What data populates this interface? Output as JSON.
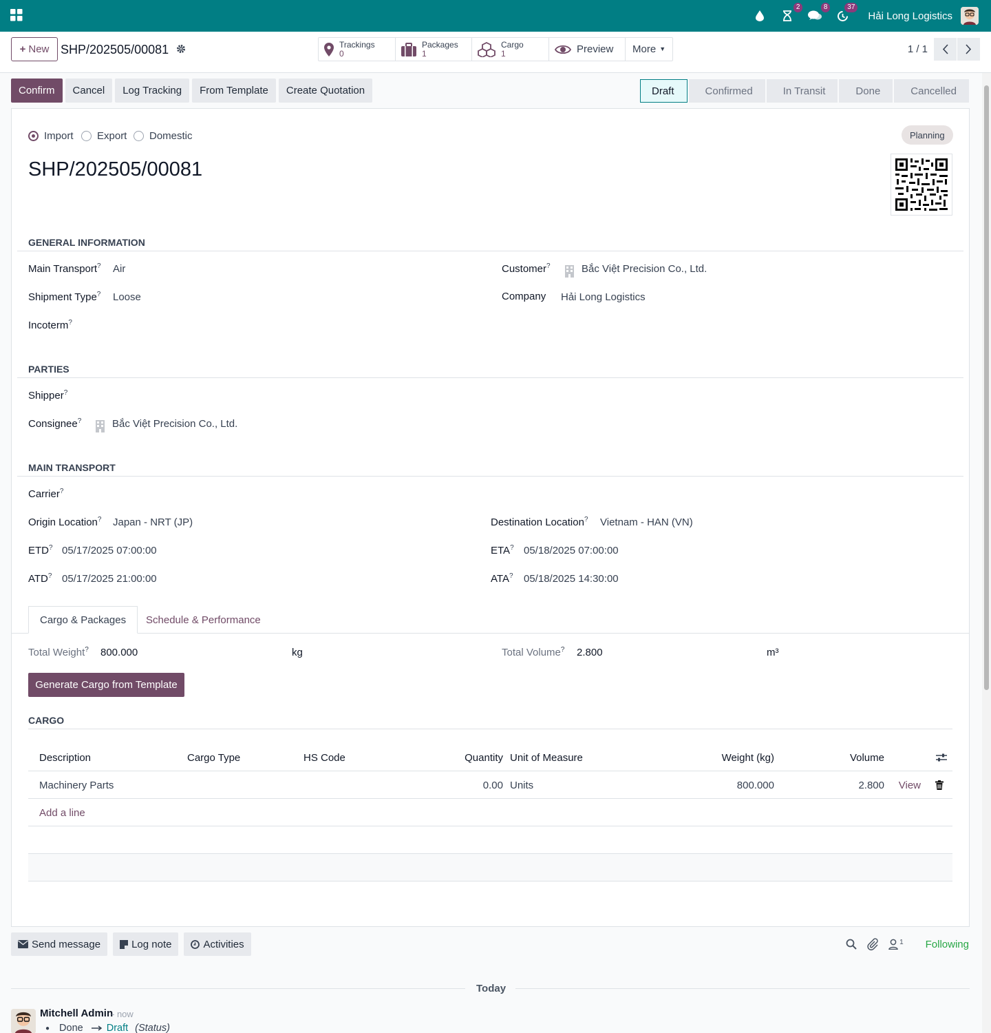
{
  "topbar": {
    "company": "Hải Long Logistics",
    "badges": {
      "activities": "2",
      "messages": "8",
      "timer": "37"
    }
  },
  "control_panel": {
    "new_label": "New",
    "record_name": "SHP/202505/00081",
    "stats": [
      {
        "label": "Trackings",
        "value": "0"
      },
      {
        "label": "Packages",
        "value": "1"
      },
      {
        "label": "Cargo",
        "value": "1"
      }
    ],
    "preview_label": "Preview",
    "more_label": "More",
    "pager": "1 / 1"
  },
  "actions": [
    "Confirm",
    "Cancel",
    "Log Tracking",
    "From Template",
    "Create Quotation"
  ],
  "statusbar": [
    "Draft",
    "Confirmed",
    "In Transit",
    "Done",
    "Cancelled"
  ],
  "statusbar_active": "Draft",
  "form": {
    "direction": {
      "options": [
        "Import",
        "Export",
        "Domestic"
      ],
      "selected": "Import"
    },
    "planning_tag": "Planning",
    "title": "SHP/202505/00081",
    "general": {
      "heading": "GENERAL INFORMATION",
      "main_transport_label": "Main Transport",
      "main_transport": "Air",
      "shipment_type_label": "Shipment Type",
      "shipment_type": "Loose",
      "incoterm_label": "Incoterm",
      "customer_label": "Customer",
      "customer": "Bắc Việt Precision Co., Ltd.",
      "company_label": "Company",
      "company": "Hải Long Logistics"
    },
    "parties": {
      "heading": "PARTIES",
      "shipper_label": "Shipper",
      "consignee_label": "Consignee",
      "consignee": "Bắc Việt Precision Co., Ltd."
    },
    "main_transport": {
      "heading": "MAIN TRANSPORT",
      "carrier_label": "Carrier",
      "origin_label": "Origin Location",
      "origin": "Japan - NRT (JP)",
      "destination_label": "Destination Location",
      "destination": "Vietnam - HAN (VN)",
      "etd_label": "ETD",
      "etd": "05/17/2025 07:00:00",
      "eta_label": "ETA",
      "eta": "05/18/2025 07:00:00",
      "atd_label": "ATD",
      "atd": "05/17/2025 21:00:00",
      "ata_label": "ATA",
      "ata": "05/18/2025 14:30:00"
    },
    "tabs": [
      "Cargo & Packages",
      "Schedule & Performance"
    ],
    "totals": {
      "weight_label": "Total Weight",
      "weight": "800.000",
      "weight_unit": "kg",
      "volume_label": "Total Volume",
      "volume": "2.800",
      "volume_unit": "m³"
    },
    "generate_label": "Generate Cargo from Template",
    "cargo": {
      "heading": "CARGO",
      "columns": [
        "Description",
        "Cargo Type",
        "HS Code",
        "Quantity",
        "Unit of Measure",
        "Weight (kg)",
        "Volume"
      ],
      "rows": [
        {
          "description": "Machinery Parts",
          "cargo_type": "",
          "hs_code": "",
          "quantity": "0.00",
          "uom": "Units",
          "weight": "800.000",
          "volume": "2.800",
          "action": "View"
        }
      ],
      "add_line": "Add a line"
    }
  },
  "chatter": {
    "send_message": "Send message",
    "log_note": "Log note",
    "activities": "Activities",
    "followers_count": "1",
    "following": "Following",
    "date_sep": "Today",
    "message": {
      "author": "Mitchell Admin",
      "time": "- now",
      "old_value": "Done",
      "new_value": "Draft",
      "field": "(Status)"
    }
  },
  "colors": {
    "topbar": "#017e84",
    "primary": "#714b67",
    "following": "#28a745"
  }
}
